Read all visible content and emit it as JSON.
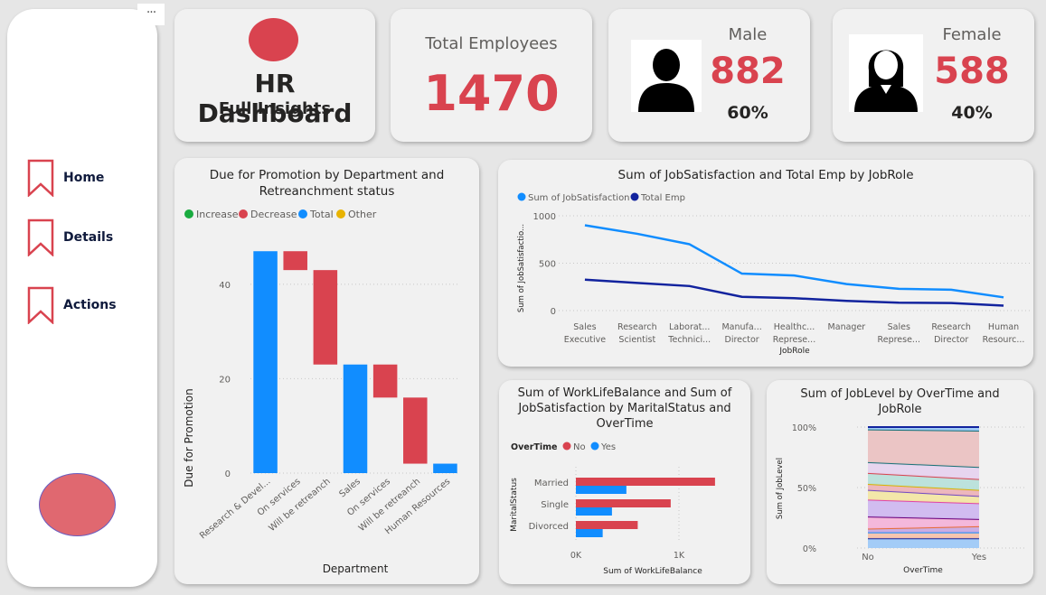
{
  "sidebar": {
    "more_label": "···",
    "items": [
      {
        "label": "Home"
      },
      {
        "label": "Details"
      },
      {
        "label": "Actions"
      }
    ]
  },
  "colors": {
    "accent": "#d9434f",
    "blue": "#118dff",
    "darkblue": "#12239e",
    "nav_text": "#0f1a3c"
  },
  "header": {
    "title": "HR Dashboard",
    "subtitle": "Full Insights"
  },
  "kpis": {
    "total_label": "Total Employees",
    "total_value": "1470",
    "male_label": "Male",
    "male_value": "882",
    "male_pct": "60%",
    "female_label": "Female",
    "female_value": "588",
    "female_pct": "40%"
  },
  "waterfall": {
    "title_line1": "Due for Promotion by Department and",
    "title_line2": "Retreanchment status",
    "legend": [
      {
        "label": "Increase",
        "color": "#1aab40"
      },
      {
        "label": "Decrease",
        "color": "#d9434f"
      },
      {
        "label": "Total",
        "color": "#118dff"
      },
      {
        "label": "Other",
        "color": "#e8b303"
      }
    ],
    "ylabel": "Due for Promotion",
    "xlabel": "Department",
    "yticks": [
      "0",
      "20",
      "40"
    ]
  },
  "line": {
    "title": "Sum of JobSatisfaction and Total Emp by JobRole",
    "legend": [
      {
        "label": "Sum of JobSatisfaction"
      },
      {
        "label": "Total Emp"
      }
    ],
    "ylabel": "Sum of JobSatisfactio...",
    "xlabel": "JobRole",
    "yticks": [
      "0",
      "500",
      "1000"
    ]
  },
  "bar": {
    "title_line1": "Sum of WorkLifeBalance and Sum of",
    "title_line2": "JobSatisfaction by MaritalStatus and",
    "title_line3": "OverTime",
    "legend_title": "OverTime",
    "legend": [
      {
        "label": "No"
      },
      {
        "label": "Yes"
      }
    ],
    "ylabel": "MaritalStatus",
    "xlabel": "Sum of WorkLifeBalance",
    "xticks": [
      "0K",
      "1K"
    ]
  },
  "area": {
    "title_line1": "Sum of JobLevel by OverTime and",
    "title_line2": "JobRole",
    "ylabel": "Sum of JobLevel",
    "xlabel": "OverTime",
    "yticks": [
      "0%",
      "50%",
      "100%"
    ]
  },
  "chart_data": [
    {
      "type": "bar",
      "chart": "waterfall",
      "categories": [
        "Research & Devel...",
        "On services",
        "Will be retreanch",
        "Sales",
        "On services",
        "Will be retreanch",
        "Human Resources"
      ],
      "values": [
        47,
        -4,
        -20,
        23,
        -7,
        -14,
        2
      ],
      "kinds": [
        "total",
        "decrease",
        "decrease",
        "total",
        "decrease",
        "decrease",
        "total"
      ],
      "ylim": [
        0,
        48
      ]
    },
    {
      "type": "line",
      "chart": "jobrole",
      "categories": [
        "Sales Executive",
        "Research Scientist",
        "Laborat... Technici...",
        "Manufa... Director",
        "Healthc... Represe...",
        "Manager",
        "Sales Represe...",
        "Research Director",
        "Human Resourc..."
      ],
      "category_lines": [
        [
          "Sales",
          "Executive"
        ],
        [
          "Research",
          "Scientist"
        ],
        [
          "Laborat...",
          "Technici..."
        ],
        [
          "Manufa...",
          "Director"
        ],
        [
          "Healthc...",
          "Represe..."
        ],
        [
          "Manager",
          ""
        ],
        [
          "Sales",
          "Represe..."
        ],
        [
          "Research",
          "Director"
        ],
        [
          "Human",
          "Resourc..."
        ]
      ],
      "series": [
        {
          "name": "Sum of JobSatisfaction",
          "values": [
            900,
            810,
            700,
            390,
            370,
            280,
            230,
            220,
            140
          ]
        },
        {
          "name": "Total Emp",
          "values": [
            326,
            292,
            259,
            145,
            131,
            102,
            83,
            80,
            52
          ]
        }
      ],
      "ylim": [
        0,
        1000
      ]
    },
    {
      "type": "bar",
      "chart": "marital",
      "orientation": "horizontal",
      "categories": [
        "Married",
        "Single",
        "Divorced"
      ],
      "series": [
        {
          "name": "No",
          "values": [
            1350,
            920,
            600
          ]
        },
        {
          "name": "Yes",
          "values": [
            490,
            350,
            260
          ]
        }
      ],
      "xlim": [
        0,
        1500
      ]
    },
    {
      "type": "area",
      "chart": "joblevel",
      "stacked_percent": true,
      "categories": [
        "No",
        "Yes"
      ],
      "boundaries_no": [
        0.08,
        0.13,
        0.16,
        0.26,
        0.4,
        0.48,
        0.53,
        0.62,
        0.71,
        0.98,
        1.0
      ],
      "boundaries_yes": [
        0.08,
        0.13,
        0.18,
        0.24,
        0.37,
        0.43,
        0.48,
        0.57,
        0.67,
        0.97,
        1.0
      ],
      "colors": [
        "#8fc3f5",
        "#12239e",
        "#118dff",
        "#f0b09a",
        "#e66c37",
        "#c5a7dd",
        "#6b007b",
        "#ee8fc8",
        "#e044a7",
        "#b78fe8",
        "#744ec2",
        "#f5e49a",
        "#d9b300",
        "#e8a6b0",
        "#d64550",
        "#b8e0da",
        "#197278"
      ],
      "ylim": [
        0,
        1
      ]
    }
  ]
}
